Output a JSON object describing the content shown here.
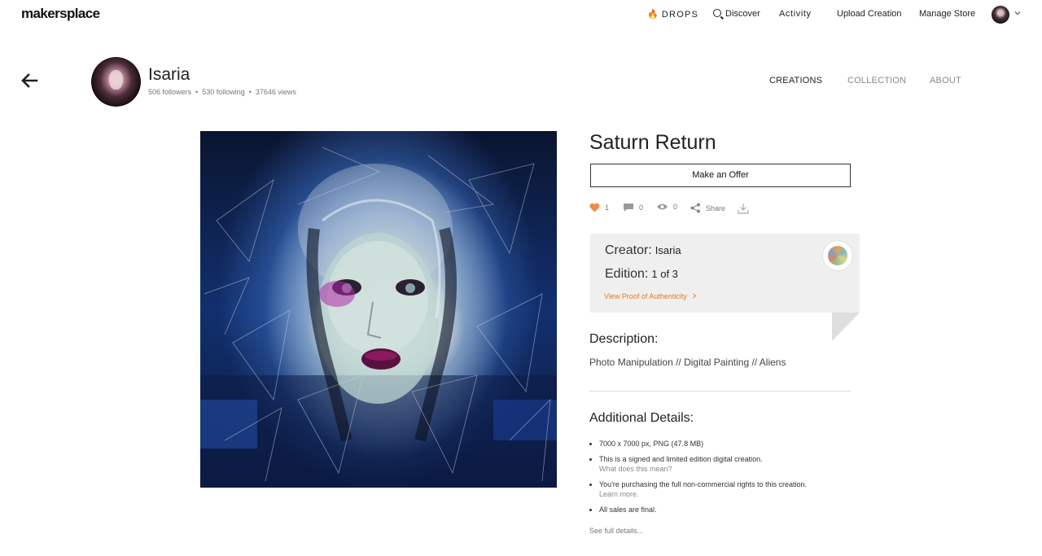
{
  "nav": {
    "logo": "makersplace",
    "drops": "DROPS",
    "discover": "Discover",
    "activity": "Activity",
    "upload": "Upload Creation",
    "manage": "Manage Store"
  },
  "profile": {
    "name": "Isaria",
    "followers": "506 followers",
    "following": "530 following",
    "views": "37646 views"
  },
  "tabs": [
    "CREATIONS",
    "COLLECTION",
    "ABOUT"
  ],
  "active_tab": "CREATIONS",
  "creation": {
    "title": "Saturn Return",
    "offer_button": "Make an Offer",
    "likes": "1",
    "comments": "0",
    "views": "0",
    "share": "Share",
    "creator_label": "Creator:",
    "creator_value": "Isaria",
    "edition_label": "Edition:",
    "edition_value": "1 of 3",
    "proof_link": "View Proof of Authenticity",
    "description_title": "Description:",
    "description": "Photo Manipulation // Digital Painting // Aliens",
    "details_title": "Additional Details:",
    "details": [
      {
        "text": "7000 x 7000 px, PNG (47.8 MB)",
        "sub": ""
      },
      {
        "text": "This is a signed and limited edition digital creation.",
        "sub": "What does this mean?"
      },
      {
        "text": "You're purchasing the full non-commercial rights to this creation.",
        "sub": "Learn more."
      },
      {
        "text": "All sales are final.",
        "sub": ""
      }
    ],
    "full_details": "See full details..."
  },
  "colors": {
    "accent_orange": "#e07b2a",
    "heart": "#f08c4a",
    "card_bg": "#efefef"
  },
  "icons": [
    "flame-icon",
    "search-icon",
    "chevron-down-icon",
    "back-arrow-icon",
    "heart-icon",
    "comment-icon",
    "eye-icon",
    "share-icon",
    "download-icon",
    "chevron-right-icon"
  ]
}
